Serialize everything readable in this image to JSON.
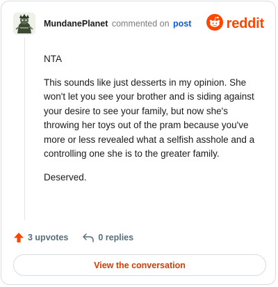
{
  "header": {
    "username": "MundanePlanet",
    "action_text": "commented on",
    "post_link": "post",
    "logo_text": "reddit"
  },
  "comment": {
    "paragraphs": [
      "NTA",
      "This sounds like just desserts in my opinion. She won't let you see your brother and is siding against your desire to see your family, but now she's throwing her toys out of the pram because you've more or less revealed what a selfish asshole and a controlling one she is to the greater family.",
      "Deserved."
    ]
  },
  "actions": {
    "upvotes": "3 upvotes",
    "replies": "0 replies"
  },
  "footer": {
    "button_label": "View the conversation"
  },
  "colors": {
    "brand": "#ff4500",
    "link": "#0b5bd3",
    "muted": "#576f76",
    "button_text": "#d93a00"
  },
  "icons": {
    "avatar": "user-avatar-icon",
    "logo": "reddit-snoo-icon",
    "upvote": "upvote-arrow-icon",
    "reply": "reply-arrow-icon"
  }
}
